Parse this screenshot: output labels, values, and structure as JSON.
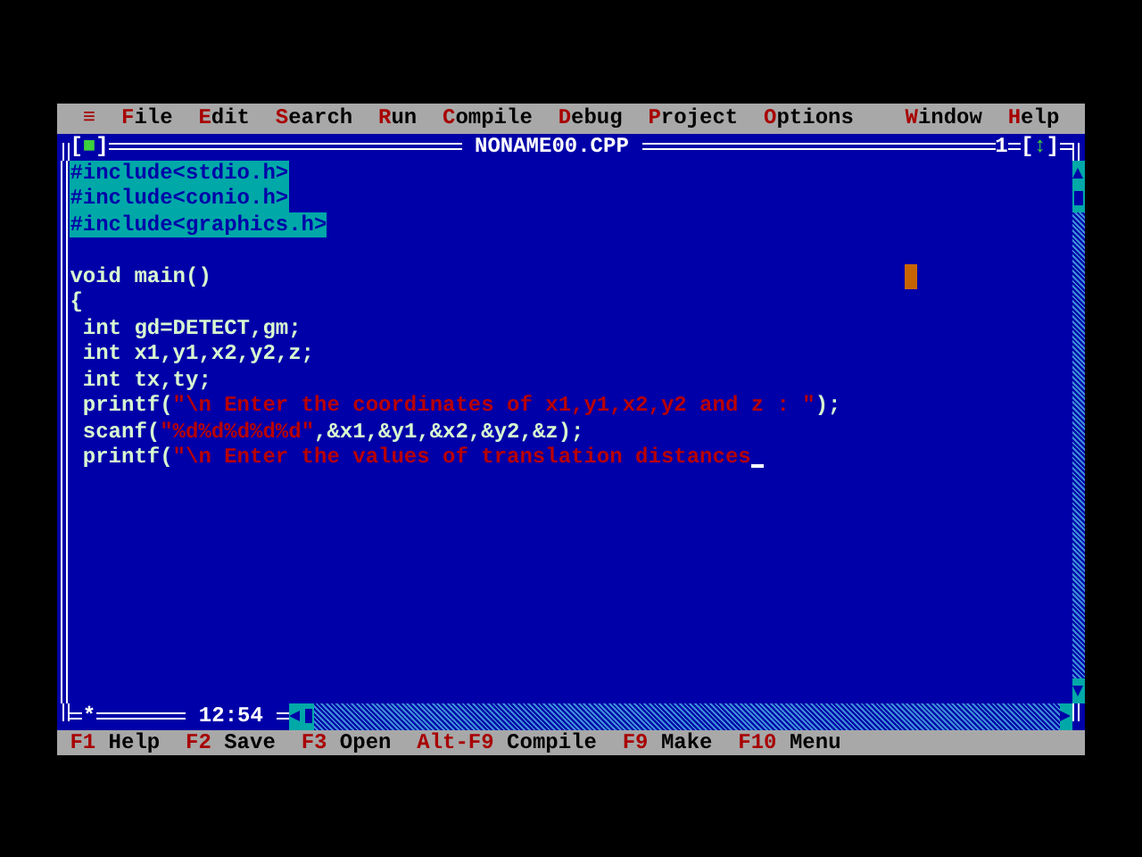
{
  "menu": {
    "left": [
      {
        "label": "≡"
      },
      {
        "label": "File"
      },
      {
        "label": "Edit"
      },
      {
        "label": "Search"
      },
      {
        "label": "Run"
      },
      {
        "label": "Compile"
      },
      {
        "label": "Debug"
      },
      {
        "label": "Project"
      },
      {
        "label": "Options"
      }
    ],
    "right": [
      {
        "label": "Window"
      },
      {
        "label": "Help"
      }
    ]
  },
  "window": {
    "close_box": "[■]",
    "title": "NONAME00.CPP",
    "number": "1",
    "zoom_box": "[↕]",
    "modified_mark": "*",
    "time": "12:54"
  },
  "code_lines": [
    {
      "kind": "code",
      "selected": true,
      "tokens": [
        {
          "text": "#include<stdio.h>",
          "kind": "plain"
        }
      ]
    },
    {
      "kind": "code",
      "selected": true,
      "tokens": [
        {
          "text": "#include<conio.h>",
          "kind": "plain"
        }
      ]
    },
    {
      "kind": "code",
      "selected": true,
      "tokens": [
        {
          "text": "#include<graphics.h>",
          "kind": "plain"
        }
      ]
    },
    {
      "kind": "blank"
    },
    {
      "kind": "code",
      "selected": false,
      "tokens": [
        {
          "text": "void main()",
          "kind": "plain"
        }
      ]
    },
    {
      "kind": "code",
      "selected": false,
      "tokens": [
        {
          "text": "{",
          "kind": "plain"
        }
      ]
    },
    {
      "kind": "code",
      "selected": false,
      "tokens": [
        {
          "text": " int gd=DETECT,gm;",
          "kind": "plain"
        }
      ]
    },
    {
      "kind": "code",
      "selected": false,
      "tokens": [
        {
          "text": " int x1,y1,x2,y2,z;",
          "kind": "plain"
        }
      ]
    },
    {
      "kind": "code",
      "selected": false,
      "tokens": [
        {
          "text": " int tx,ty;",
          "kind": "plain"
        }
      ]
    },
    {
      "kind": "code",
      "selected": false,
      "tokens": [
        {
          "text": " printf(",
          "kind": "plain"
        },
        {
          "text": "\"\\n Enter the coordinates of x1,y1,x2,y2 and z : \"",
          "kind": "string"
        },
        {
          "text": ");",
          "kind": "plain"
        }
      ]
    },
    {
      "kind": "code",
      "selected": false,
      "tokens": [
        {
          "text": " scanf(",
          "kind": "plain"
        },
        {
          "text": "\"%d%d%d%d%d\"",
          "kind": "string"
        },
        {
          "text": ",&x1,&y1,&x2,&y2,&z);",
          "kind": "plain"
        }
      ]
    },
    {
      "kind": "code",
      "selected": false,
      "cursor": true,
      "tokens": [
        {
          "text": " printf(",
          "kind": "plain"
        },
        {
          "text": "\"\\n Enter the values of translation distances",
          "kind": "string"
        }
      ]
    }
  ],
  "status_bar": [
    {
      "key": "F1",
      "label": "Help"
    },
    {
      "key": "F2",
      "label": "Save"
    },
    {
      "key": "F3",
      "label": "Open"
    },
    {
      "key": "Alt-F9",
      "label": "Compile"
    },
    {
      "key": "F9",
      "label": "Make"
    },
    {
      "key": "F10",
      "label": "Menu"
    }
  ]
}
